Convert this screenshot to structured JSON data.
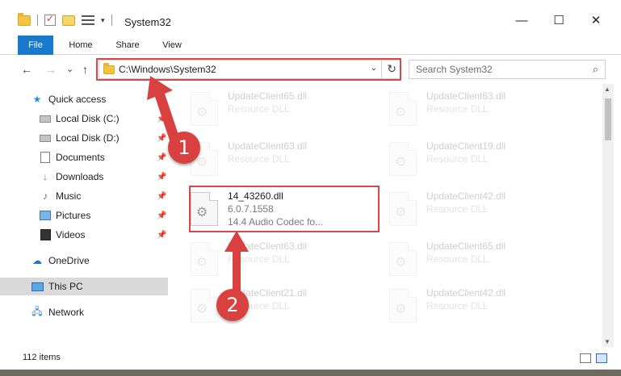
{
  "window": {
    "title": "System32",
    "minimize_glyph": "—",
    "maximize_glyph": "☐",
    "close_glyph": "✕"
  },
  "ribbon": {
    "tabs": [
      {
        "label": "File"
      },
      {
        "label": "Home"
      },
      {
        "label": "Share"
      },
      {
        "label": "View"
      }
    ]
  },
  "nav": {
    "back_glyph": "←",
    "forward_glyph": "→",
    "recent_glyph": "⌄",
    "up_glyph": "↑",
    "address": "C:\\Windows\\System32",
    "search_placeholder": "Search System32"
  },
  "sidebar": {
    "items": [
      {
        "label": "Quick access",
        "icon": "star-icon"
      },
      {
        "label": "Local Disk (C:)",
        "icon": "drive-icon",
        "pinned": true
      },
      {
        "label": "Local Disk (D:)",
        "icon": "drive-icon",
        "pinned": true
      },
      {
        "label": "Documents",
        "icon": "documents-icon",
        "pinned": true
      },
      {
        "label": "Downloads",
        "icon": "downloads-icon",
        "pinned": true
      },
      {
        "label": "Music",
        "icon": "music-icon",
        "pinned": true
      },
      {
        "label": "Pictures",
        "icon": "pictures-icon",
        "pinned": true
      },
      {
        "label": "Videos",
        "icon": "videos-icon",
        "pinned": true
      },
      {
        "label": "OneDrive",
        "icon": "cloud-icon"
      },
      {
        "label": "This PC",
        "icon": "computer-icon",
        "selected": true
      },
      {
        "label": "Network",
        "icon": "network-icon"
      }
    ]
  },
  "files": [
    {
      "name": "UpdateClient65.dll",
      "desc": "Resource DLL"
    },
    {
      "name": "UpdateClient63.dll",
      "desc": "Resource DLL"
    },
    {
      "name": "UpdateClient63.dll",
      "desc": "Resource DLL"
    },
    {
      "name": "UpdateClient19.dll",
      "desc": "Resource DLL"
    },
    {
      "name": "14_43260.dll",
      "version": "6.0.7.1558",
      "desc": "14.4 Audio Codec fo..."
    },
    {
      "name": "UpdateClient42.dll",
      "desc": "Resource DLL"
    },
    {
      "name": "UpdateClient63.dll",
      "desc": "Resource DLL"
    },
    {
      "name": "UpdateClient65.dll",
      "desc": "Resource DLL"
    },
    {
      "name": "UpdateClient21.dll",
      "desc": "Resource DLL"
    },
    {
      "name": "UpdateClient42.dll",
      "desc": "Resource DLL"
    }
  ],
  "status": {
    "item_count": "112 items"
  },
  "annotations": {
    "step1": "1",
    "step2": "2",
    "color": "#d94040"
  },
  "colors": {
    "accent": "#1979ca",
    "highlight_border": "#d24a4a",
    "selected_bg": "#d9d9d9"
  }
}
